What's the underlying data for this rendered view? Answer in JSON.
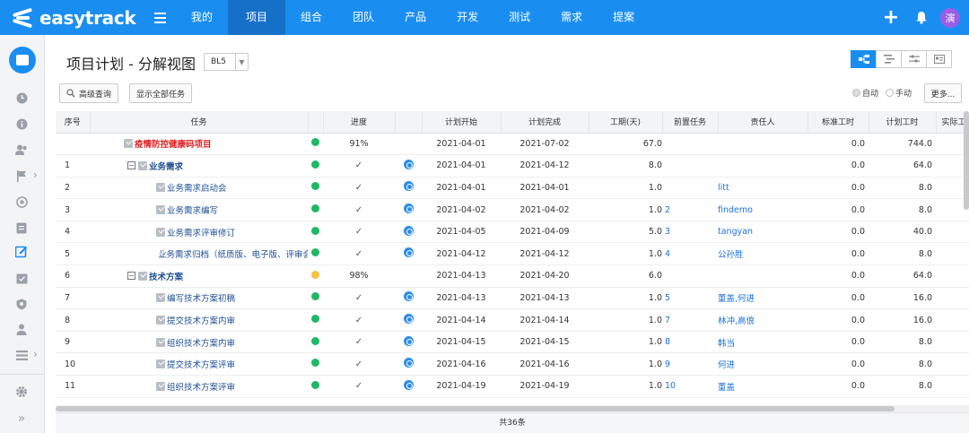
{
  "app": {
    "logo": "easytrack"
  },
  "nav": {
    "items": [
      {
        "label": "我的",
        "active": false
      },
      {
        "label": "项目",
        "active": true
      },
      {
        "label": "组合",
        "active": false
      },
      {
        "label": "团队",
        "active": false
      },
      {
        "label": "产品",
        "active": false
      },
      {
        "label": "开发",
        "active": false
      },
      {
        "label": "测试",
        "active": false
      },
      {
        "label": "需求",
        "active": false
      },
      {
        "label": "提案",
        "active": false
      }
    ],
    "avatar": "演"
  },
  "page": {
    "title": "项目计划 - 分解视图",
    "baseline": "BL5",
    "advanced_search": "高级查询",
    "show_all": "显示全部任务",
    "radio_auto": "自动",
    "radio_manual": "手动",
    "more": "更多...",
    "footer": "共36条"
  },
  "colors": {
    "brand": "#1a8ef0",
    "status_green": "#1fb866",
    "status_yellow": "#f5c242"
  },
  "table": {
    "columns": [
      "序号",
      "任务",
      "",
      "进度",
      "",
      "计划开始",
      "计划完成",
      "工期(天)",
      "前置任务",
      "责任人",
      "标准工时",
      "计划工时",
      "实际工时"
    ],
    "rows": [
      {
        "seq": "",
        "level": 0,
        "name": "疫情防控健康码项目",
        "status": "green",
        "progress": "91%",
        "clock": false,
        "start": "2021-04-01",
        "end": "2021-07-02",
        "duration": "67.0",
        "pred": "",
        "owner": "",
        "std": "0.0",
        "plan": "744.0"
      },
      {
        "seq": "1",
        "level": 1,
        "name": "业务需求",
        "status": "green",
        "progress": "✓",
        "clock": true,
        "start": "2021-04-01",
        "end": "2021-04-12",
        "duration": "8.0",
        "pred": "",
        "owner": "",
        "std": "0.0",
        "plan": "64.0"
      },
      {
        "seq": "2",
        "level": 2,
        "name": "业务需求启动会",
        "status": "green",
        "progress": "✓",
        "clock": true,
        "start": "2021-04-01",
        "end": "2021-04-01",
        "duration": "1.0",
        "pred": "",
        "owner": "litt",
        "std": "0.0",
        "plan": "8.0"
      },
      {
        "seq": "3",
        "level": 2,
        "name": "业务需求编写",
        "status": "green",
        "progress": "✓",
        "clock": true,
        "start": "2021-04-02",
        "end": "2021-04-02",
        "duration": "1.0",
        "pred": "2",
        "owner": "findemo",
        "std": "0.0",
        "plan": "8.0"
      },
      {
        "seq": "4",
        "level": 2,
        "name": "业务需求评审修订",
        "status": "green",
        "progress": "✓",
        "clock": true,
        "start": "2021-04-05",
        "end": "2021-04-09",
        "duration": "5.0",
        "pred": "3",
        "owner": "tangyan",
        "std": "0.0",
        "plan": "40.0"
      },
      {
        "seq": "5",
        "level": 2,
        "name": "业务需求归档（纸质版、电子版、评审会议",
        "status": "green",
        "progress": "✓",
        "clock": true,
        "start": "2021-04-12",
        "end": "2021-04-12",
        "duration": "1.0",
        "pred": "4",
        "owner": "公孙胜",
        "std": "0.0",
        "plan": "8.0"
      },
      {
        "seq": "6",
        "level": 1,
        "name": "技术方案",
        "status": "yellow",
        "progress": "98%",
        "clock": false,
        "start": "2021-04-13",
        "end": "2021-04-20",
        "duration": "6.0",
        "pred": "",
        "owner": "",
        "std": "0.0",
        "plan": "64.0"
      },
      {
        "seq": "7",
        "level": 2,
        "name": "编写技术方案初稿",
        "status": "green",
        "progress": "✓",
        "clock": true,
        "start": "2021-04-13",
        "end": "2021-04-13",
        "duration": "1.0",
        "pred": "5",
        "owner": "董盖,何进",
        "std": "0.0",
        "plan": "16.0"
      },
      {
        "seq": "8",
        "level": 2,
        "name": "提交技术方案内审",
        "status": "green",
        "progress": "✓",
        "clock": true,
        "start": "2021-04-14",
        "end": "2021-04-14",
        "duration": "1.0",
        "pred": "7",
        "owner": "林冲,高俍",
        "std": "0.0",
        "plan": "16.0"
      },
      {
        "seq": "9",
        "level": 2,
        "name": "组织技术方案内审",
        "status": "green",
        "progress": "✓",
        "clock": true,
        "start": "2021-04-15",
        "end": "2021-04-15",
        "duration": "1.0",
        "pred": "8",
        "owner": "韩当",
        "std": "0.0",
        "plan": "8.0"
      },
      {
        "seq": "10",
        "level": 2,
        "name": "提交技术方案评审",
        "status": "green",
        "progress": "✓",
        "clock": true,
        "start": "2021-04-16",
        "end": "2021-04-16",
        "duration": "1.0",
        "pred": "9",
        "owner": "何进",
        "std": "0.0",
        "plan": "8.0"
      },
      {
        "seq": "11",
        "level": 2,
        "name": "组织技术方案评审",
        "status": "green",
        "progress": "✓",
        "clock": true,
        "start": "2021-04-19",
        "end": "2021-04-19",
        "duration": "1.0",
        "pred": "10",
        "owner": "董盖",
        "std": "0.0",
        "plan": "8.0"
      }
    ]
  }
}
